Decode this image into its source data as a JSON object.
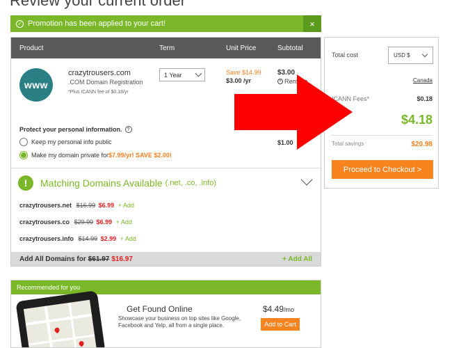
{
  "page_title": "Review your current order",
  "promo": {
    "message": "Promotion has been applied to your cart!",
    "close": "×",
    "check": "✓"
  },
  "cart": {
    "headers": {
      "product": "Product",
      "term": "Term",
      "unit_price": "Unit Price",
      "subtotal": "Subtotal"
    },
    "item": {
      "logo_text": "www",
      "domain": "crazytrousers.com",
      "description": ".COM Domain Registration",
      "fee_note": "*Plus ICANN fee of $0.18/yr",
      "term_value": "1 Year",
      "save_text": "Save $14.99",
      "unit_price": "$3.00 /yr",
      "subtotal": "$3.00",
      "remove_label": "Remove",
      "remove_icon": "×"
    },
    "privacy": {
      "title": "Protect your personal information.",
      "help_icon": "?",
      "option_public": "Keep my personal info public",
      "option_private_prefix": "Make my domain private for ",
      "option_private_price": "$7.99/yr! SAVE $2.00!",
      "total": "$1.00"
    },
    "matching": {
      "icon": "!",
      "title": "Matching Domains Available",
      "extensions": "(.net, .co, .info)",
      "domains": [
        {
          "name": "crazytrousers.net",
          "old": "$16.99",
          "new": "$6.99",
          "add": "+ Add"
        },
        {
          "name": "crazytrousers.co",
          "old": "$29.99",
          "new": "$6.99",
          "add": "+ Add"
        },
        {
          "name": "crazytrousers.info",
          "old": "$14.99",
          "new": "$2.99",
          "add": "+ Add"
        }
      ],
      "add_all_prefix": "Add All Domains for",
      "add_all_old": "$61.97",
      "add_all_new": "$16.97",
      "add_all_button": "+ Add All"
    }
  },
  "summary": {
    "total_cost_label": "Total cost",
    "currency": "USD $",
    "canada_link": "Canada",
    "icann_label": "ICANN Fees*",
    "icann_value": "$0.18",
    "total": "$4.18",
    "savings_label": "Total savings",
    "savings_value": "$20.98",
    "checkout_button": "Proceed to Checkout >"
  },
  "recommended": {
    "header": "Recommended for you",
    "title": "Get Found Online",
    "description": "Showcase your business on top sites like Google, Facebook and Yelp, all from a single place.",
    "price": "$4.49",
    "price_unit": "/mo",
    "add_button": "Add to Cart"
  },
  "colors": {
    "green": "#7ab829",
    "orange": "#f7841f",
    "red_arrow": "#ff0000",
    "header_gray": "#595959",
    "teal_logo": "#2a7f85"
  }
}
